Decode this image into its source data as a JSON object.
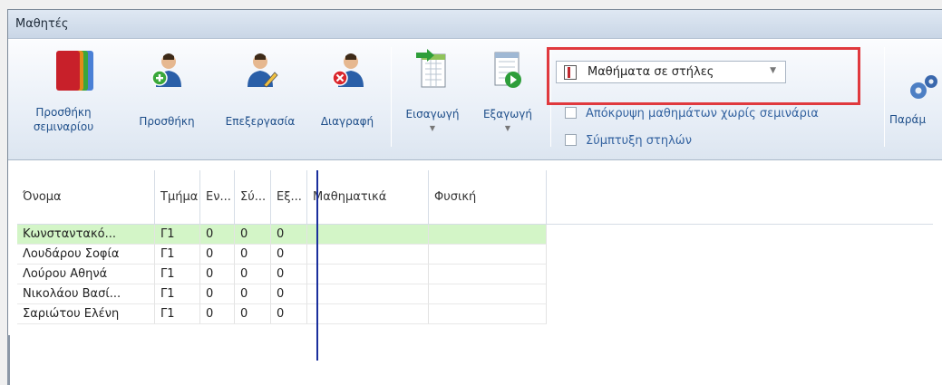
{
  "window": {
    "title": "Μαθητές"
  },
  "ribbon": {
    "add_seminar": "Προσθήκη σεμιναρίου",
    "add": "Προσθήκη",
    "edit": "Επεξεργασία",
    "delete": "Διαγραφή",
    "import": "Εισαγωγή",
    "export": "Εξαγωγή",
    "settings": "Παράμ",
    "view_combo": {
      "value": "Μαθήματα σε στήλες"
    },
    "hide_lessons": "Απόκρυψη μαθημάτων χωρίς σεμινάρια",
    "collapse_columns": "Σύμπτυξη στηλών"
  },
  "table": {
    "columns": [
      "Όνομα",
      "Τμήμα",
      "Εν...",
      "Σύ...",
      "Εξ...",
      "Μαθηματικά",
      "Φυσική"
    ],
    "rows": [
      [
        "Κωνσταντακό...",
        "Γ1",
        "0",
        "0",
        "0",
        "",
        ""
      ],
      [
        "Λουδάρου Σοφία",
        "Γ1",
        "0",
        "0",
        "0",
        "",
        ""
      ],
      [
        "Λούρου Αθηνά",
        "Γ1",
        "0",
        "0",
        "0",
        "",
        ""
      ],
      [
        "Νικολάου Βασί...",
        "Γ1",
        "0",
        "0",
        "0",
        "",
        ""
      ],
      [
        "Σαριώτου Ελένη",
        "Γ1",
        "0",
        "0",
        "0",
        "",
        ""
      ]
    ],
    "selected_row": 0
  },
  "colors": {
    "accent": "#1f4f8a",
    "selected_row": "#d3f5c7",
    "highlight": "#e0393e"
  }
}
